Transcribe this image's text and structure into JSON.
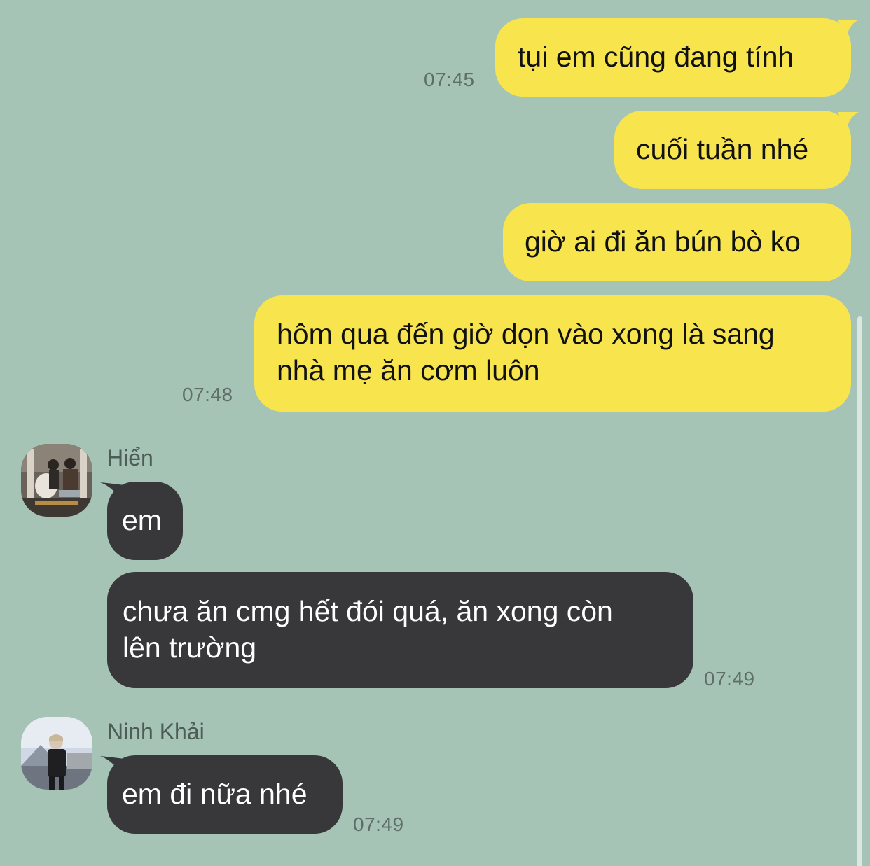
{
  "messages_out": [
    {
      "text": "tụi em cũng đang tính",
      "time": "07:45"
    },
    {
      "text": "cuối tuần nhé"
    },
    {
      "text": "giờ ai đi ăn bún bò ko"
    },
    {
      "lines": [
        "hôm qua đến giờ dọn vào xong là sang",
        "nhà mẹ ăn cơm luôn"
      ],
      "time": "07:48"
    }
  ],
  "groups_in": [
    {
      "sender": "Hiển",
      "avatar_icon": "user-photo-icon",
      "messages": [
        {
          "text": "em"
        },
        {
          "lines": [
            "chưa ăn cmg hết đói quá, ăn xong còn",
            "lên trường"
          ],
          "time": "07:49"
        }
      ]
    },
    {
      "sender": "Ninh Khải",
      "avatar_icon": "user-photo-icon",
      "messages": [
        {
          "text": "em đi nữa nhé",
          "time": "07:49"
        }
      ]
    }
  ],
  "colors": {
    "background": "#a6c4b5",
    "outgoing_bubble": "#f8e54e",
    "incoming_bubble": "#38383b",
    "timestamp": "#5f6f67"
  }
}
